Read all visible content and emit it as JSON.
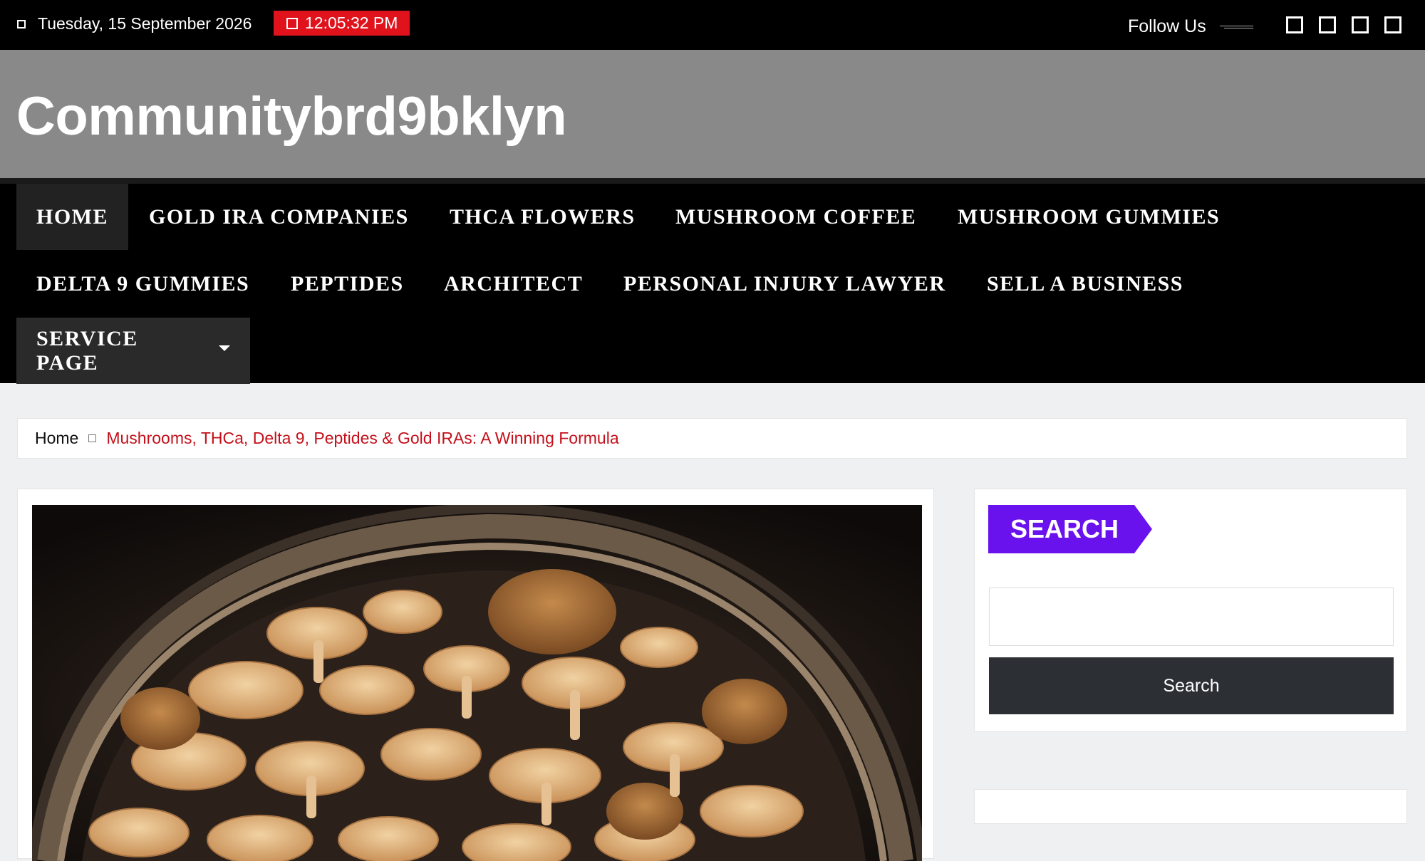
{
  "topbar": {
    "date": "Tuesday, 15 September 2026",
    "time": "12:05:32 PM",
    "follow_label": "Follow Us",
    "social_icons": [
      "social-icon-1",
      "social-icon-2",
      "social-icon-3",
      "social-icon-4"
    ],
    "time_bg_color": "#e0121c"
  },
  "site": {
    "title": "Communitybrd9bklyn"
  },
  "nav": {
    "items": [
      {
        "label": "HOME",
        "active": true
      },
      {
        "label": "GOLD IRA COMPANIES"
      },
      {
        "label": "THCA FLOWERS"
      },
      {
        "label": "MUSHROOM COFFEE"
      },
      {
        "label": "MUSHROOM GUMMIES"
      },
      {
        "label": "DELTA 9 GUMMIES"
      },
      {
        "label": "PEPTIDES"
      },
      {
        "label": "ARCHITECT"
      },
      {
        "label": "PERSONAL INJURY LAWYER"
      },
      {
        "label": "SELL A BUSINESS"
      },
      {
        "label": "SERVICE PAGE",
        "has_dropdown": true
      }
    ]
  },
  "breadcrumb": {
    "home": "Home",
    "current": "Mushrooms, THCa, Delta 9, Peptides & Gold IRAs: A Winning Formula",
    "current_color": "#c4101a"
  },
  "sidebar": {
    "search_title": "SEARCH",
    "search_title_color": "#6a12ee",
    "search_value": "",
    "search_button": "Search"
  }
}
